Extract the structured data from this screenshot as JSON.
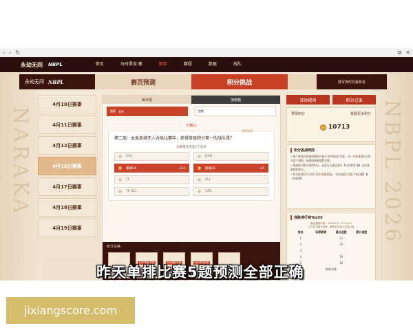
{
  "browser": {
    "back": "‹",
    "forward": "›",
    "reload": "↻",
    "window_btn": "⧉",
    "close_btn": "✕"
  },
  "topnav": {
    "logo": "永劫无间",
    "brand": "NBPL",
    "items": [
      "首页",
      "与时俱竞·春",
      "赛事",
      "赛程",
      "数据",
      "战队"
    ],
    "active_index": 2
  },
  "header": {
    "logo": "永劫无间",
    "brand": "NBPL",
    "tab_predict": "赛页预测",
    "tab_challenge": "积分挑战",
    "note": "赛写竞时的最新看"
  },
  "dates": [
    "4月10日赛事",
    "4月11日赛事",
    "4月12日赛事",
    "4月16日赛事",
    "4月17日赛事",
    "4月18日赛事",
    "4月19日赛事"
  ],
  "dates_active_index": 3,
  "center": {
    "subtab_daily": "每日题",
    "subtab_extra": "加倍题",
    "mini_options": [
      {
        "label": "狐尾",
        "value": "100",
        "selected": true
      },
      {
        "label": "困兽",
        "value": "",
        "selected": false
      }
    ],
    "closed": "已截止",
    "question": "第二局：本局单排天人对局比赛中，获得单局积分第一的战队是？",
    "rule_link": "规则答案",
    "subline": "本题最多可选2个选项",
    "options": [
      {
        "name": "CSG",
        "val": "",
        "selected": false
      },
      {
        "name": "DUG",
        "val": "",
        "selected": false
      },
      {
        "name": "狐尾DK",
        "val": "10.0",
        "selected": true
      },
      {
        "name": "狐尾QC",
        "val": "4.9",
        "selected": true
      },
      {
        "name": "TJ",
        "val": "",
        "selected": false
      },
      {
        "name": "ALL",
        "val": "",
        "selected": false
      },
      {
        "name": "YK S11",
        "val": "",
        "selected": false
      },
      {
        "name": "XAG",
        "val": "",
        "selected": false
      }
    ],
    "bottom_label": "积分兑换",
    "gifts": [
      {
        "tag": "",
        "name": "丹心证物语 礼 *1"
      },
      {
        "tag": "1000积分兑换",
        "name": "【与时俱竞】 福灵石*1"
      },
      {
        "tag": "800积分兑换",
        "name": "【与时俱竞】 福祝石*1"
      },
      {
        "tag": "500积分兑换",
        "name": "英雄宝 宝物箱"
      },
      {
        "tag": "",
        "name": ""
      }
    ]
  },
  "right": {
    "tab_activity": "活动规则",
    "tab_record": "积分记录",
    "pred_label": "预测积分",
    "get_more": "获取更多积分",
    "points": "10713",
    "rules_title": "积分挑战规则",
    "rules": [
      "• 每个赛段在资格周期内可参与\"积分挑战\"页面，可一次性获得600积分用于预测，每赛段刷新重置次数。",
      "• 预测成功即可获得积分，玩家可以通过参与【与时俱竞·春】活动获取预测积分。",
      "• 积分获得后可以用于积分兑换奖励，\"积分挑战\"页面【每日题】和【加倍题】"
    ],
    "rank_title": "连胜排行榜Top50",
    "rank_update": "最近更新时间：2026-4-17 10:30:00",
    "rank_sub": "以下仅为部分玩家，具体名次请以实际为准",
    "rank_headers": [
      "排名",
      "玩家昵称",
      "最长连胜",
      "累计连胜"
    ],
    "rank_rows": [
      [
        "1",
        "",
        "22",
        ""
      ],
      [
        "2",
        "",
        "20",
        ""
      ],
      [
        "3",
        "",
        "",
        ""
      ],
      [
        "4",
        "",
        "19",
        ""
      ],
      [
        "5",
        "",
        "18",
        ""
      ]
    ],
    "rank_footer": "刷新次数"
  },
  "caption": "昨天单排比赛5题预测全部正确",
  "deco_left": "NARAKA",
  "deco_right": "NBPL 2026",
  "watermark": "jixiangscore.com"
}
